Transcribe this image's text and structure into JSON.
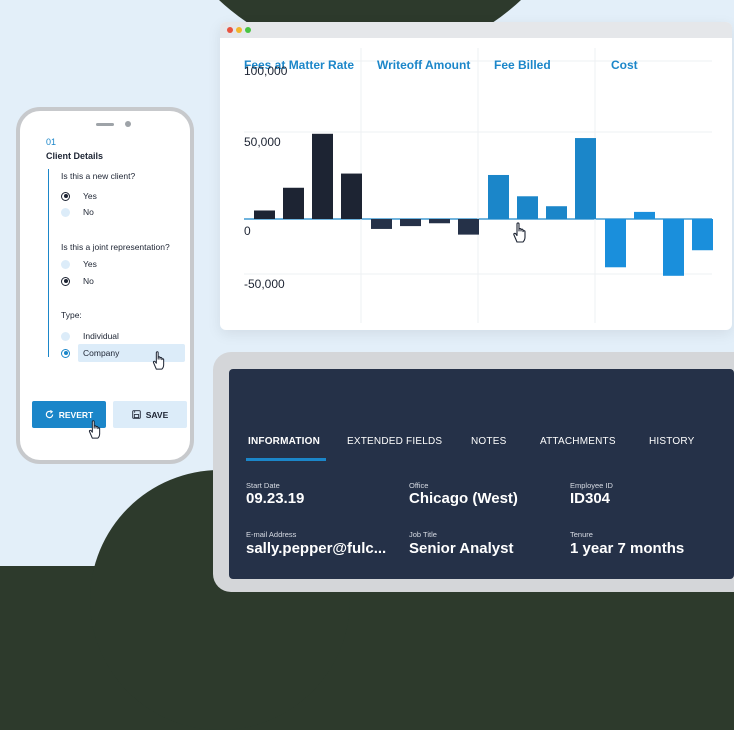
{
  "chart_data": {
    "type": "bar",
    "columns": [
      "Fees at Matter Rate",
      "Writeoff Amount",
      "Fee Billed",
      "Cost"
    ],
    "y_ticks": [
      "100,000",
      "50,000",
      "0",
      "-50,000"
    ],
    "ylim": [
      -55000,
      105000
    ],
    "grid": true,
    "series": [
      {
        "values": [
          6000,
          22000,
          60000,
          32000
        ],
        "color": "#1d2433"
      },
      {
        "values": [
          -7000,
          -5000,
          -3000,
          -11000
        ],
        "color": "#253148"
      },
      {
        "values": [
          31000,
          16000,
          9000,
          57000
        ],
        "color": "#1b86c9"
      },
      {
        "values": [
          -34000,
          5000,
          -40000,
          -22000
        ],
        "color": "#1a8fdc"
      }
    ]
  },
  "form": {
    "step_number": "01",
    "step_title": "Client Details",
    "questions": [
      {
        "label": "Is this a new client?",
        "options": [
          "Yes",
          "No"
        ],
        "selected": "Yes"
      },
      {
        "label": "Is this a joint representation?",
        "options": [
          "Yes",
          "No"
        ],
        "selected": "No"
      },
      {
        "label": "Type:",
        "options": [
          "Individual",
          "Company"
        ],
        "selected": "Company"
      }
    ],
    "revert_label": "REVERT",
    "save_label": "SAVE"
  },
  "record": {
    "tabs": [
      "INFORMATION",
      "EXTENDED FIELDS",
      "NOTES",
      "ATTACHMENTS",
      "HISTORY"
    ],
    "active_tab": "INFORMATION",
    "fields": [
      {
        "label": "Start Date",
        "value": "09.23.19"
      },
      {
        "label": "Office",
        "value": "Chicago (West)"
      },
      {
        "label": "Employee ID",
        "value": "ID304"
      },
      {
        "label": "E-mail Address",
        "value": "sally.pepper@fulc..."
      },
      {
        "label": "Job Title",
        "value": "Senior Analyst"
      },
      {
        "label": "Tenure",
        "value": "1 year 7 months"
      }
    ]
  },
  "colors": {
    "accent": "#1b86c9",
    "navy": "#1d2433",
    "panel_bg": "#253148",
    "light_blue": "#dcecf9"
  },
  "icons": [
    "refresh-icon",
    "save-icon",
    "pointer-hand-icon"
  ]
}
